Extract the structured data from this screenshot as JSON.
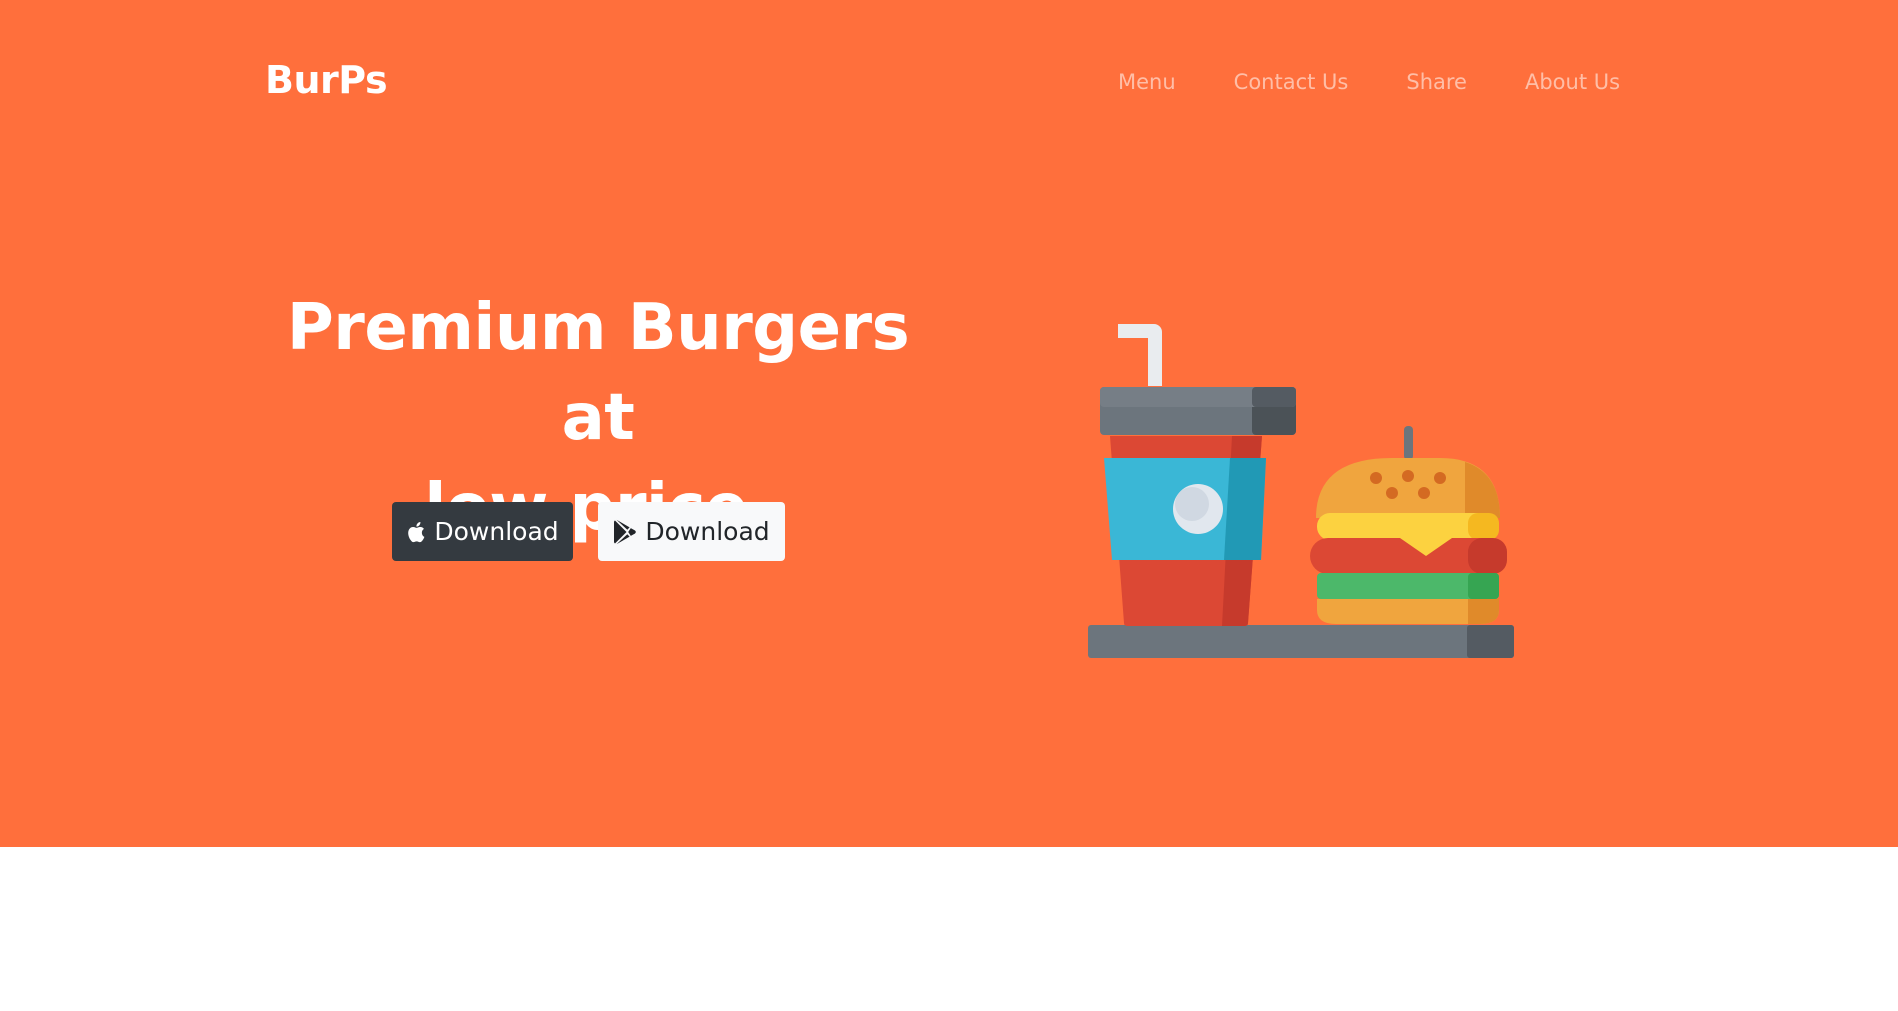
{
  "navbar": {
    "brand": "BurPs",
    "links": [
      "Menu",
      "Contact Us",
      "Share",
      "About Us"
    ]
  },
  "hero": {
    "headline_line1": "Premium Burgers at",
    "headline_line2": "low price.",
    "buttons": [
      {
        "label": "Download",
        "icon": "apple-icon"
      },
      {
        "label": "Download",
        "icon": "google-play-icon"
      }
    ],
    "illustration": "drink-and-burger-illustration"
  },
  "colors": {
    "hero_background": "#ff6f3c",
    "brand_text": "#ffffff",
    "nav_link": "rgba(255,255,255,0.55)",
    "apple_button": "#343a40",
    "google_button": "#f8f9fa"
  }
}
